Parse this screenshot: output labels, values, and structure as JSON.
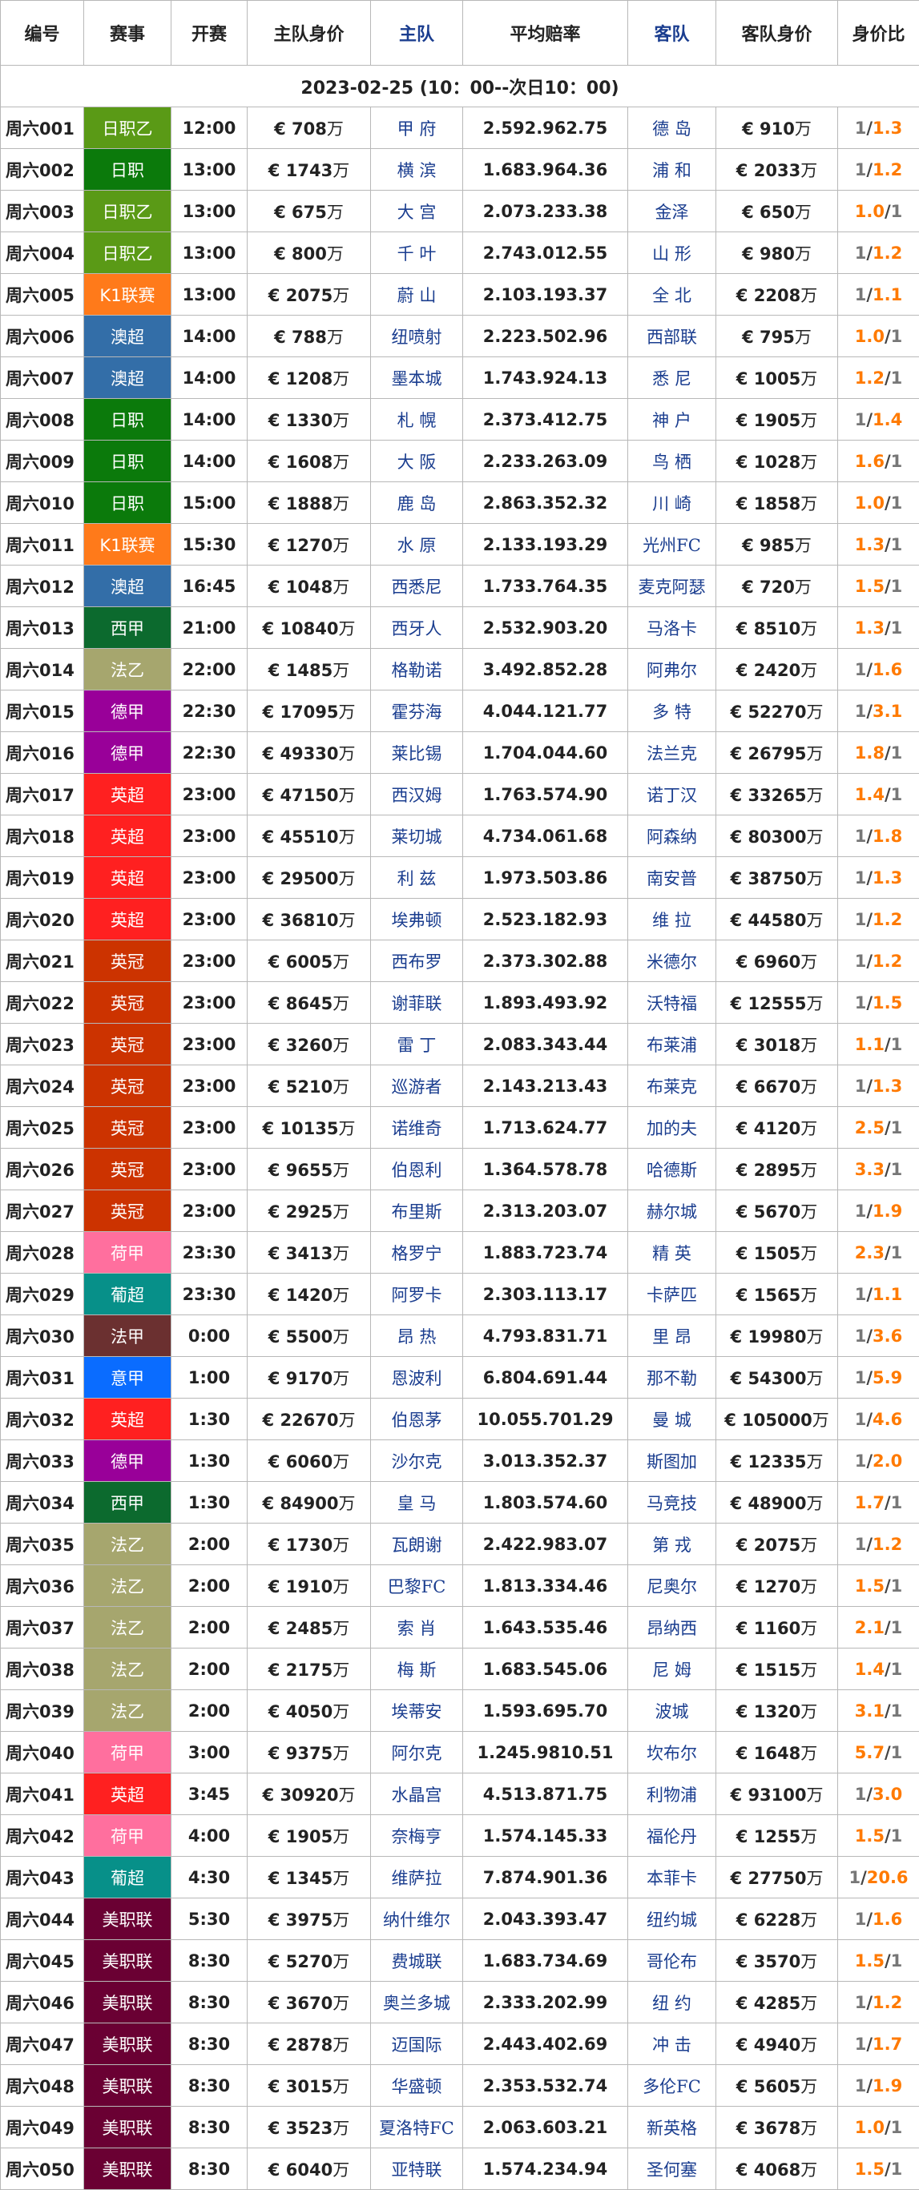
{
  "headers": [
    "编号",
    "赛事",
    "开赛",
    "主队身价",
    "主队",
    "平均赔率",
    "客队",
    "客队身价",
    "身价比"
  ],
  "date_line": "2023-02-25 (10：00--次日10：00)",
  "unit": "万",
  "currency": "€",
  "league_colors": {
    "日职乙": "#5a9a16",
    "日职": "#0b7a0b",
    "K1联赛": "#ff7a1a",
    "澳超": "#336ea8",
    "西甲": "#0c6a2e",
    "法乙": "#a6a66e",
    "德甲": "#990099",
    "英超": "#ff2020",
    "英冠": "#cc3300",
    "荷甲": "#ff6f9e",
    "葡超": "#079089",
    "法甲": "#6b3030",
    "意甲": "#0a6cff",
    "美职联": "#6a0033"
  },
  "matches": [
    {
      "no": "周六001",
      "league": "日职乙",
      "time": "12:00",
      "home_val": "708",
      "home": "甲 府",
      "odds": "2.592.962.75",
      "away": "德 岛",
      "away_val": "910",
      "ratio": [
        "1",
        "1.3"
      ]
    },
    {
      "no": "周六002",
      "league": "日职",
      "time": "13:00",
      "home_val": "1743",
      "home": "横 滨",
      "odds": "1.683.964.36",
      "away": "浦 和",
      "away_val": "2033",
      "ratio": [
        "1",
        "1.2"
      ]
    },
    {
      "no": "周六003",
      "league": "日职乙",
      "time": "13:00",
      "home_val": "675",
      "home": "大 宫",
      "odds": "2.073.233.38",
      "away": "金泽",
      "away_val": "650",
      "ratio": [
        "1.0",
        "1"
      ]
    },
    {
      "no": "周六004",
      "league": "日职乙",
      "time": "13:00",
      "home_val": "800",
      "home": "千 叶",
      "odds": "2.743.012.55",
      "away": "山 形",
      "away_val": "980",
      "ratio": [
        "1",
        "1.2"
      ]
    },
    {
      "no": "周六005",
      "league": "K1联赛",
      "time": "13:00",
      "home_val": "2075",
      "home": "蔚 山",
      "odds": "2.103.193.37",
      "away": "全 北",
      "away_val": "2208",
      "ratio": [
        "1",
        "1.1"
      ]
    },
    {
      "no": "周六006",
      "league": "澳超",
      "time": "14:00",
      "home_val": "788",
      "home": "纽喷射",
      "odds": "2.223.502.96",
      "away": "西部联",
      "away_val": "795",
      "ratio": [
        "1.0",
        "1"
      ]
    },
    {
      "no": "周六007",
      "league": "澳超",
      "time": "14:00",
      "home_val": "1208",
      "home": "墨本城",
      "odds": "1.743.924.13",
      "away": "悉 尼",
      "away_val": "1005",
      "ratio": [
        "1.2",
        "1"
      ]
    },
    {
      "no": "周六008",
      "league": "日职",
      "time": "14:00",
      "home_val": "1330",
      "home": "札 幌",
      "odds": "2.373.412.75",
      "away": "神 户",
      "away_val": "1905",
      "ratio": [
        "1",
        "1.4"
      ]
    },
    {
      "no": "周六009",
      "league": "日职",
      "time": "14:00",
      "home_val": "1608",
      "home": "大 阪",
      "odds": "2.233.263.09",
      "away": "鸟 栖",
      "away_val": "1028",
      "ratio": [
        "1.6",
        "1"
      ]
    },
    {
      "no": "周六010",
      "league": "日职",
      "time": "15:00",
      "home_val": "1888",
      "home": "鹿 岛",
      "odds": "2.863.352.32",
      "away": "川 崎",
      "away_val": "1858",
      "ratio": [
        "1.0",
        "1"
      ]
    },
    {
      "no": "周六011",
      "league": "K1联赛",
      "time": "15:30",
      "home_val": "1270",
      "home": "水 原",
      "odds": "2.133.193.29",
      "away": "光州FC",
      "away_val": "985",
      "ratio": [
        "1.3",
        "1"
      ]
    },
    {
      "no": "周六012",
      "league": "澳超",
      "time": "16:45",
      "home_val": "1048",
      "home": "西悉尼",
      "odds": "1.733.764.35",
      "away": "麦克阿瑟",
      "away_val": "720",
      "ratio": [
        "1.5",
        "1"
      ]
    },
    {
      "no": "周六013",
      "league": "西甲",
      "time": "21:00",
      "home_val": "10840",
      "home": "西牙人",
      "odds": "2.532.903.20",
      "away": "马洛卡",
      "away_val": "8510",
      "ratio": [
        "1.3",
        "1"
      ]
    },
    {
      "no": "周六014",
      "league": "法乙",
      "time": "22:00",
      "home_val": "1485",
      "home": "格勒诺",
      "odds": "3.492.852.28",
      "away": "阿弗尔",
      "away_val": "2420",
      "ratio": [
        "1",
        "1.6"
      ]
    },
    {
      "no": "周六015",
      "league": "德甲",
      "time": "22:30",
      "home_val": "17095",
      "home": "霍芬海",
      "odds": "4.044.121.77",
      "away": "多 特",
      "away_val": "52270",
      "ratio": [
        "1",
        "3.1"
      ]
    },
    {
      "no": "周六016",
      "league": "德甲",
      "time": "22:30",
      "home_val": "49330",
      "home": "莱比锡",
      "odds": "1.704.044.60",
      "away": "法兰克",
      "away_val": "26795",
      "ratio": [
        "1.8",
        "1"
      ]
    },
    {
      "no": "周六017",
      "league": "英超",
      "time": "23:00",
      "home_val": "47150",
      "home": "西汉姆",
      "odds": "1.763.574.90",
      "away": "诺丁汉",
      "away_val": "33265",
      "ratio": [
        "1.4",
        "1"
      ]
    },
    {
      "no": "周六018",
      "league": "英超",
      "time": "23:00",
      "home_val": "45510",
      "home": "莱切城",
      "odds": "4.734.061.68",
      "away": "阿森纳",
      "away_val": "80300",
      "ratio": [
        "1",
        "1.8"
      ]
    },
    {
      "no": "周六019",
      "league": "英超",
      "time": "23:00",
      "home_val": "29500",
      "home": "利 兹",
      "odds": "1.973.503.86",
      "away": "南安普",
      "away_val": "38750",
      "ratio": [
        "1",
        "1.3"
      ]
    },
    {
      "no": "周六020",
      "league": "英超",
      "time": "23:00",
      "home_val": "36810",
      "home": "埃弗顿",
      "odds": "2.523.182.93",
      "away": "维 拉",
      "away_val": "44580",
      "ratio": [
        "1",
        "1.2"
      ]
    },
    {
      "no": "周六021",
      "league": "英冠",
      "time": "23:00",
      "home_val": "6005",
      "home": "西布罗",
      "odds": "2.373.302.88",
      "away": "米德尔",
      "away_val": "6960",
      "ratio": [
        "1",
        "1.2"
      ]
    },
    {
      "no": "周六022",
      "league": "英冠",
      "time": "23:00",
      "home_val": "8645",
      "home": "谢菲联",
      "odds": "1.893.493.92",
      "away": "沃特福",
      "away_val": "12555",
      "ratio": [
        "1",
        "1.5"
      ]
    },
    {
      "no": "周六023",
      "league": "英冠",
      "time": "23:00",
      "home_val": "3260",
      "home": "雷 丁",
      "odds": "2.083.343.44",
      "away": "布莱浦",
      "away_val": "3018",
      "ratio": [
        "1.1",
        "1"
      ]
    },
    {
      "no": "周六024",
      "league": "英冠",
      "time": "23:00",
      "home_val": "5210",
      "home": "巡游者",
      "odds": "2.143.213.43",
      "away": "布莱克",
      "away_val": "6670",
      "ratio": [
        "1",
        "1.3"
      ]
    },
    {
      "no": "周六025",
      "league": "英冠",
      "time": "23:00",
      "home_val": "10135",
      "home": "诺维奇",
      "odds": "1.713.624.77",
      "away": "加的夫",
      "away_val": "4120",
      "ratio": [
        "2.5",
        "1"
      ]
    },
    {
      "no": "周六026",
      "league": "英冠",
      "time": "23:00",
      "home_val": "9655",
      "home": "伯恩利",
      "odds": "1.364.578.78",
      "away": "哈德斯",
      "away_val": "2895",
      "ratio": [
        "3.3",
        "1"
      ]
    },
    {
      "no": "周六027",
      "league": "英冠",
      "time": "23:00",
      "home_val": "2925",
      "home": "布里斯",
      "odds": "2.313.203.07",
      "away": "赫尔城",
      "away_val": "5670",
      "ratio": [
        "1",
        "1.9"
      ]
    },
    {
      "no": "周六028",
      "league": "荷甲",
      "time": "23:30",
      "home_val": "3413",
      "home": "格罗宁",
      "odds": "1.883.723.74",
      "away": "精 英",
      "away_val": "1505",
      "ratio": [
        "2.3",
        "1"
      ]
    },
    {
      "no": "周六029",
      "league": "葡超",
      "time": "23:30",
      "home_val": "1420",
      "home": "阿罗卡",
      "odds": "2.303.113.17",
      "away": "卡萨匹",
      "away_val": "1565",
      "ratio": [
        "1",
        "1.1"
      ]
    },
    {
      "no": "周六030",
      "league": "法甲",
      "time": "0:00",
      "home_val": "5500",
      "home": "昂 热",
      "odds": "4.793.831.71",
      "away": "里 昂",
      "away_val": "19980",
      "ratio": [
        "1",
        "3.6"
      ]
    },
    {
      "no": "周六031",
      "league": "意甲",
      "time": "1:00",
      "home_val": "9170",
      "home": "恩波利",
      "odds": "6.804.691.44",
      "away": "那不勒",
      "away_val": "54300",
      "ratio": [
        "1",
        "5.9"
      ]
    },
    {
      "no": "周六032",
      "league": "英超",
      "time": "1:30",
      "home_val": "22670",
      "home": "伯恩茅",
      "odds": "10.055.701.29",
      "away": "曼 城",
      "away_val": "105000",
      "ratio": [
        "1",
        "4.6"
      ]
    },
    {
      "no": "周六033",
      "league": "德甲",
      "time": "1:30",
      "home_val": "6060",
      "home": "沙尔克",
      "odds": "3.013.352.37",
      "away": "斯图加",
      "away_val": "12335",
      "ratio": [
        "1",
        "2.0"
      ]
    },
    {
      "no": "周六034",
      "league": "西甲",
      "time": "1:30",
      "home_val": "84900",
      "home": "皇 马",
      "odds": "1.803.574.60",
      "away": "马竞技",
      "away_val": "48900",
      "ratio": [
        "1.7",
        "1"
      ]
    },
    {
      "no": "周六035",
      "league": "法乙",
      "time": "2:00",
      "home_val": "1730",
      "home": "瓦朗谢",
      "odds": "2.422.983.07",
      "away": "第 戎",
      "away_val": "2075",
      "ratio": [
        "1",
        "1.2"
      ]
    },
    {
      "no": "周六036",
      "league": "法乙",
      "time": "2:00",
      "home_val": "1910",
      "home": "巴黎FC",
      "odds": "1.813.334.46",
      "away": "尼奥尔",
      "away_val": "1270",
      "ratio": [
        "1.5",
        "1"
      ]
    },
    {
      "no": "周六037",
      "league": "法乙",
      "time": "2:00",
      "home_val": "2485",
      "home": "索 肖",
      "odds": "1.643.535.46",
      "away": "昂纳西",
      "away_val": "1160",
      "ratio": [
        "2.1",
        "1"
      ]
    },
    {
      "no": "周六038",
      "league": "法乙",
      "time": "2:00",
      "home_val": "2175",
      "home": "梅 斯",
      "odds": "1.683.545.06",
      "away": "尼 姆",
      "away_val": "1515",
      "ratio": [
        "1.4",
        "1"
      ]
    },
    {
      "no": "周六039",
      "league": "法乙",
      "time": "2:00",
      "home_val": "4050",
      "home": "埃蒂安",
      "odds": "1.593.695.70",
      "away": "波城",
      "away_val": "1320",
      "ratio": [
        "3.1",
        "1"
      ]
    },
    {
      "no": "周六040",
      "league": "荷甲",
      "time": "3:00",
      "home_val": "9375",
      "home": "阿尔克",
      "odds": "1.245.9810.51",
      "away": "坎布尔",
      "away_val": "1648",
      "ratio": [
        "5.7",
        "1"
      ]
    },
    {
      "no": "周六041",
      "league": "英超",
      "time": "3:45",
      "home_val": "30920",
      "home": "水晶宫",
      "odds": "4.513.871.75",
      "away": "利物浦",
      "away_val": "93100",
      "ratio": [
        "1",
        "3.0"
      ]
    },
    {
      "no": "周六042",
      "league": "荷甲",
      "time": "4:00",
      "home_val": "1905",
      "home": "奈梅亨",
      "odds": "1.574.145.33",
      "away": "福伦丹",
      "away_val": "1255",
      "ratio": [
        "1.5",
        "1"
      ]
    },
    {
      "no": "周六043",
      "league": "葡超",
      "time": "4:30",
      "home_val": "1345",
      "home": "维萨拉",
      "odds": "7.874.901.36",
      "away": "本菲卡",
      "away_val": "27750",
      "ratio": [
        "1",
        "20.6"
      ]
    },
    {
      "no": "周六044",
      "league": "美职联",
      "time": "5:30",
      "home_val": "3975",
      "home": "纳什维尔",
      "odds": "2.043.393.47",
      "away": "纽约城",
      "away_val": "6228",
      "ratio": [
        "1",
        "1.6"
      ]
    },
    {
      "no": "周六045",
      "league": "美职联",
      "time": "8:30",
      "home_val": "5270",
      "home": "费城联",
      "odds": "1.683.734.69",
      "away": "哥伦布",
      "away_val": "3570",
      "ratio": [
        "1.5",
        "1"
      ]
    },
    {
      "no": "周六046",
      "league": "美职联",
      "time": "8:30",
      "home_val": "3670",
      "home": "奥兰多城",
      "odds": "2.333.202.99",
      "away": "纽 约",
      "away_val": "4285",
      "ratio": [
        "1",
        "1.2"
      ]
    },
    {
      "no": "周六047",
      "league": "美职联",
      "time": "8:30",
      "home_val": "2878",
      "home": "迈国际",
      "odds": "2.443.402.69",
      "away": "冲 击",
      "away_val": "4940",
      "ratio": [
        "1",
        "1.7"
      ]
    },
    {
      "no": "周六048",
      "league": "美职联",
      "time": "8:30",
      "home_val": "3015",
      "home": "华盛顿",
      "odds": "2.353.532.74",
      "away": "多伦FC",
      "away_val": "5605",
      "ratio": [
        "1",
        "1.9"
      ]
    },
    {
      "no": "周六049",
      "league": "美职联",
      "time": "8:30",
      "home_val": "3523",
      "home": "夏洛特FC",
      "odds": "2.063.603.21",
      "away": "新英格",
      "away_val": "3678",
      "ratio": [
        "1.0",
        "1"
      ]
    },
    {
      "no": "周六050",
      "league": "美职联",
      "time": "8:30",
      "home_val": "6040",
      "home": "亚特联",
      "odds": "1.574.234.94",
      "away": "圣何塞",
      "away_val": "4068",
      "ratio": [
        "1.5",
        "1"
      ]
    }
  ]
}
